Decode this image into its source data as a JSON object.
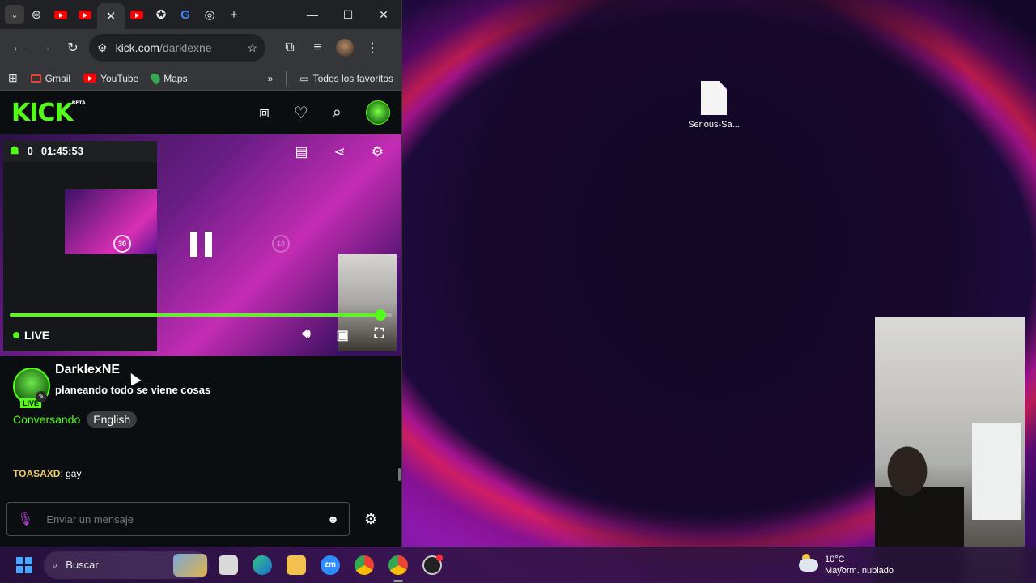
{
  "desktop": {
    "icon_label": "Serious-Sa..."
  },
  "browser": {
    "window_controls": {
      "minimize": "—",
      "maximize": "☐",
      "close": "✕"
    },
    "address": {
      "host": "kick.com",
      "path": "/darklexne"
    },
    "bookmarks": [
      {
        "label": "Gmail",
        "icon": "gmail-icon"
      },
      {
        "label": "YouTube",
        "icon": "youtube-icon"
      },
      {
        "label": "Maps",
        "icon": "maps-icon"
      }
    ],
    "bookmarks_more": "»",
    "all_bookmarks": "Todos los favoritos"
  },
  "kick": {
    "logo": "KICK",
    "beta": "BETA",
    "player": {
      "viewers": "0",
      "uptime": "01:45:53",
      "live_label": "LIVE",
      "skip_back": "30",
      "skip_forward": "10",
      "progress": 0.97
    },
    "channel": {
      "name": "DarklexNE",
      "live_badge": "LIVE",
      "title": "planeando todo se viene cosas",
      "category": "Conversando",
      "language": "English"
    },
    "chat": {
      "messages": [
        {
          "user": "TOASAXD",
          "text": ": gay"
        }
      ],
      "input_placeholder": "Enviar un mensaje"
    }
  },
  "taskbar": {
    "search_label": "Buscar",
    "apps": [
      "files",
      "edge",
      "file-explorer",
      "zoom",
      "chrome",
      "chrome-active",
      "obs"
    ],
    "zoom_label": "zm",
    "weather": {
      "temp": "10°C",
      "condition": "Mayorm. nublado"
    }
  },
  "colors": {
    "kick_green": "#53fc18",
    "chat_username": "#f0c96b",
    "mic_purple": "#b43bd6"
  }
}
